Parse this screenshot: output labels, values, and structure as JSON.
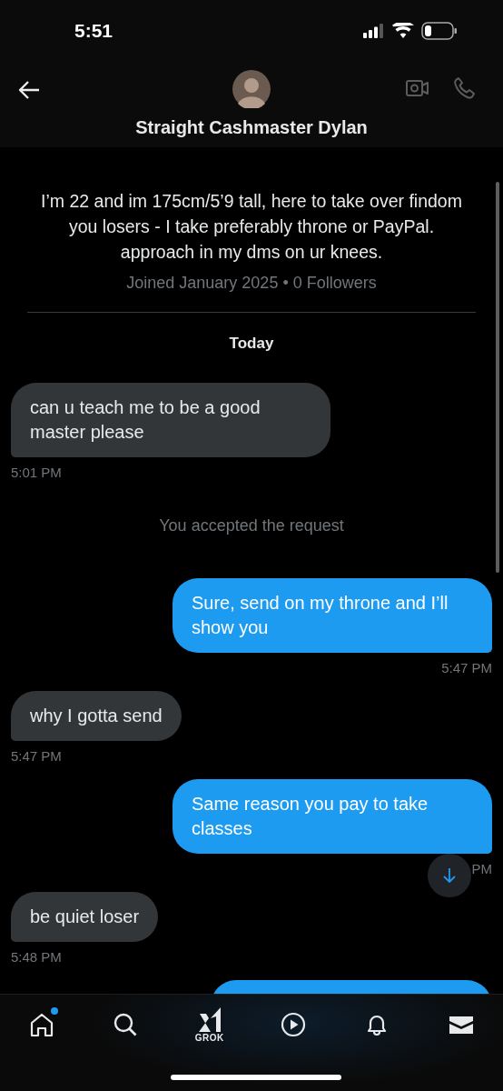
{
  "status_bar": {
    "time": "5:51"
  },
  "header": {
    "name": "Straight Cashmaster Dylan",
    "actions": [
      {
        "kind": "video",
        "disabled": true
      },
      {
        "kind": "call",
        "disabled": true
      }
    ]
  },
  "profile": {
    "bio": "I’m 22 and im 175cm/5’9 tall, here to take over findom you losers - I take preferably throne or PayPal. approach in my dms on ur knees.",
    "meta": "Joined January 2025 • 0 Followers"
  },
  "day_label": "Today",
  "messages": [
    {
      "kind": "received",
      "text": "can u teach me to be a good master please",
      "time": "5:01 PM"
    },
    {
      "kind": "system",
      "text": "You accepted the request"
    },
    {
      "kind": "sent",
      "text": "Sure, send on my throne and I’ll show you",
      "time": "5:47 PM"
    },
    {
      "kind": "received",
      "text": "why I gotta send",
      "time": "5:47 PM"
    },
    {
      "kind": "sent",
      "text": "Same reason you pay to take classes",
      "time": "PM"
    },
    {
      "kind": "received",
      "text": "be quiet loser",
      "time": "5:48 PM"
    },
    {
      "kind": "sent"
    }
  ],
  "nav": [
    {
      "kind": "home",
      "selected": false,
      "dot": true
    },
    {
      "kind": "search",
      "selected": false,
      "dot": false
    },
    {
      "kind": "grok",
      "label": "GROK",
      "selected": false,
      "dot": false
    },
    {
      "kind": "video",
      "selected": false,
      "dot": false
    },
    {
      "kind": "notifications",
      "selected": false,
      "dot": false
    },
    {
      "kind": "messages",
      "selected": true,
      "dot": false
    }
  ]
}
